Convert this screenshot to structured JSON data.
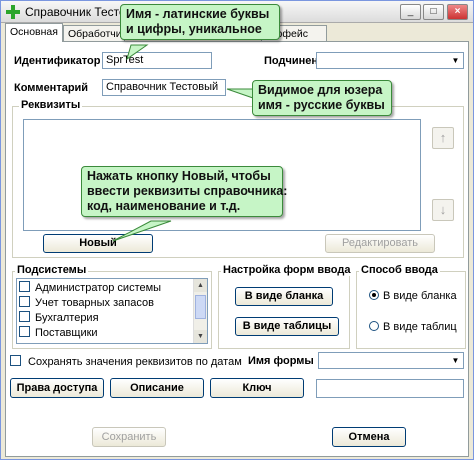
{
  "window": {
    "title": "Справочник Тестовый",
    "minimize": "_",
    "maximize": "□",
    "close": "×"
  },
  "tabs": [
    {
      "label": "Основная",
      "active": true
    },
    {
      "label": "Обработчик",
      "active": false
    },
    {
      "label": "терфейс",
      "active": false
    }
  ],
  "form": {
    "identifier_label": "Идентификатор",
    "identifier_value": "SprTest",
    "subordinate_label": "Подчинен",
    "subordinate_value": "",
    "comment_label": "Комментарий",
    "comment_value": "Справочник Тестовый"
  },
  "requisites": {
    "title": "Реквизиты",
    "new_button": "Новый",
    "edit_button": "Редактировать",
    "up_arrow": "↑",
    "down_arrow": "↓"
  },
  "subsystems": {
    "title": "Подсистемы",
    "items": [
      "Администратор системы",
      "Учет товарных запасов",
      "Бухгалтерия",
      "Поставщики"
    ]
  },
  "input_forms": {
    "title": "Настройка форм ввода",
    "form_button": "В виде бланка",
    "table_button": "В виде таблицы"
  },
  "input_method": {
    "title": "Способ ввода",
    "option_form": "В виде бланка",
    "option_table": "В виде таблиц",
    "selected": "В виде бланка"
  },
  "bottom": {
    "save_by_dates": "Сохранять значения реквизитов по датам",
    "form_name_label": "Имя формы",
    "form_name_value": "",
    "access_button": "Права доступа",
    "description_button": "Описание",
    "key_button": "Ключ",
    "key_value": "",
    "save_button": "Сохранить",
    "cancel_button": "Отмена"
  },
  "callouts": {
    "name_hint_1": "Имя - латинские буквы",
    "name_hint_2": "и цифры, уникальное",
    "visible_hint_1": "Видимое для юзера",
    "visible_hint_2": "имя - русские буквы",
    "new_hint_1": "Нажать кнопку Новый, чтобы",
    "new_hint_2": "ввести реквизиты справочника:",
    "new_hint_3": "код, наименование и т.д."
  },
  "colors": {
    "callout_bg": "#c6f5c6",
    "callout_border": "#3b8a3b",
    "window_border": "#7a96df"
  }
}
